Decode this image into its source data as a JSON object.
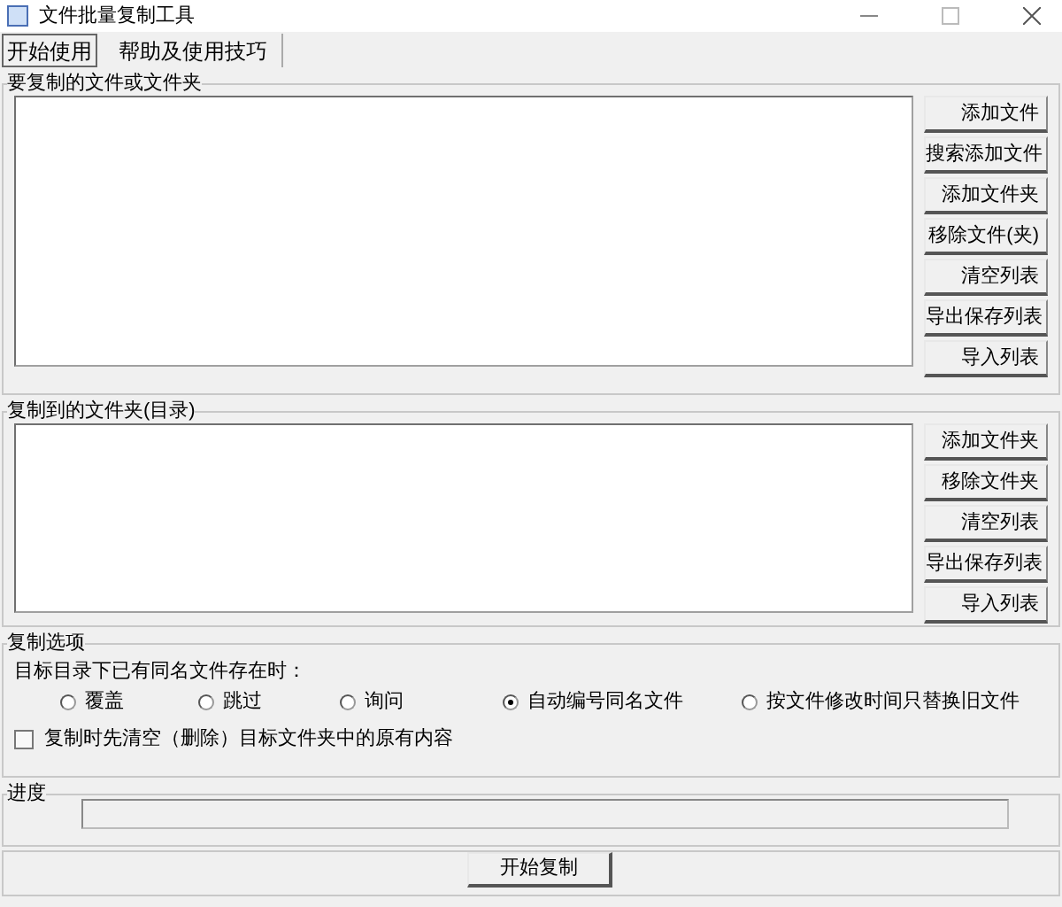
{
  "window": {
    "title": "文件批量复制工具"
  },
  "tabs": [
    {
      "label": "开始使用",
      "selected": true
    },
    {
      "label": "帮助及使用技巧",
      "selected": false
    }
  ],
  "source_group": {
    "title": "要复制的文件或文件夹",
    "buttons": [
      "添加文件",
      "搜索添加文件",
      "添加文件夹",
      "移除文件(夹)",
      "清空列表",
      "导出保存列表",
      "导入列表"
    ]
  },
  "target_group": {
    "title": "复制到的文件夹(目录)",
    "buttons": [
      "添加文件夹",
      "移除文件夹",
      "清空列表",
      "导出保存列表",
      "导入列表"
    ]
  },
  "options_group": {
    "title": "复制选项",
    "prompt": "目标目录下已有同名文件存在时：",
    "radios": [
      {
        "label": "覆盖",
        "selected": false
      },
      {
        "label": "跳过",
        "selected": false
      },
      {
        "label": "询问",
        "selected": false
      },
      {
        "label": "自动编号同名文件",
        "selected": true
      },
      {
        "label": "按文件修改时间只替换旧文件",
        "selected": false
      }
    ],
    "checkbox": {
      "label": "复制时先清空（删除）目标文件夹中的原有内容",
      "checked": false
    }
  },
  "progress_group": {
    "title": "进度",
    "level": 0
  },
  "start_button": "开始复制"
}
